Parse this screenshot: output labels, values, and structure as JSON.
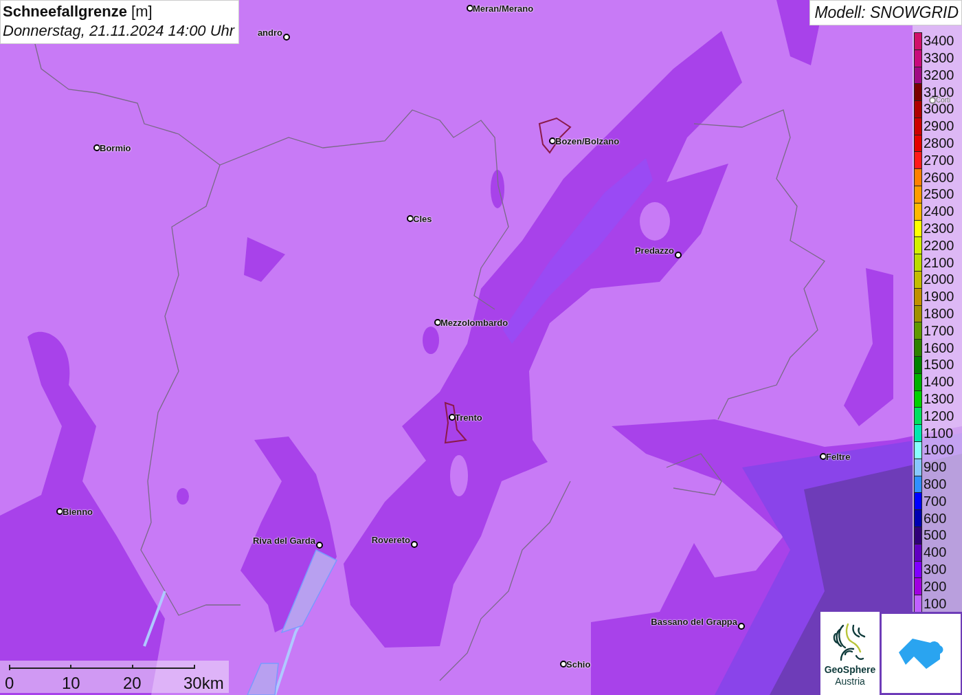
{
  "title": {
    "heading": "**Schneefallgrenze** [m]",
    "datetime": "Donnerstag, 21.11.2024 14:00 Uhr"
  },
  "model": "Modell: SNOWGRID",
  "legend": [
    {
      "label": "3400",
      "color": "#d0106a"
    },
    {
      "label": "3300",
      "color": "#c80a7c"
    },
    {
      "label": "3200",
      "color": "#a00a84"
    },
    {
      "label": "3100",
      "color": "#7a0000"
    },
    {
      "label": "3000",
      "color": "#ae0000"
    },
    {
      "label": "2900",
      "color": "#cc0000"
    },
    {
      "label": "2800",
      "color": "#e40000"
    },
    {
      "label": "2700",
      "color": "#ff1a1a"
    },
    {
      "label": "2600",
      "color": "#ff8000"
    },
    {
      "label": "2500",
      "color": "#ff9c00"
    },
    {
      "label": "2400",
      "color": "#ffb800"
    },
    {
      "label": "2300",
      "color": "#ffff00"
    },
    {
      "label": "2200",
      "color": "#d4f000"
    },
    {
      "label": "2100",
      "color": "#bcdc00"
    },
    {
      "label": "2000",
      "color": "#c4bc00"
    },
    {
      "label": "1900",
      "color": "#c09000"
    },
    {
      "label": "1800",
      "color": "#a09000"
    },
    {
      "label": "1700",
      "color": "#609800"
    },
    {
      "label": "1600",
      "color": "#2e8000"
    },
    {
      "label": "1500",
      "color": "#008000"
    },
    {
      "label": "1400",
      "color": "#00b000"
    },
    {
      "label": "1300",
      "color": "#00d000"
    },
    {
      "label": "1200",
      "color": "#00e060"
    },
    {
      "label": "1100",
      "color": "#00e8b0"
    },
    {
      "label": "1000",
      "color": "#88ffff"
    },
    {
      "label": "900",
      "color": "#88c8ff"
    },
    {
      "label": "800",
      "color": "#3090ff"
    },
    {
      "label": "700",
      "color": "#0000ff"
    },
    {
      "label": "600",
      "color": "#0000b0"
    },
    {
      "label": "500",
      "color": "#300078"
    },
    {
      "label": "400",
      "color": "#6000c0"
    },
    {
      "label": "300",
      "color": "#8000ff"
    },
    {
      "label": "200",
      "color": "#a000e0"
    },
    {
      "label": "100",
      "color": "#c060ff"
    }
  ],
  "places": [
    {
      "name": "Meran/Merano"
    },
    {
      "name": "andro"
    },
    {
      "name": "Bormio"
    },
    {
      "name": "Bozen/Bolzano"
    },
    {
      "name": "Cles"
    },
    {
      "name": "Predazzo"
    },
    {
      "name": "Mezzolombardo"
    },
    {
      "name": "Trento"
    },
    {
      "name": "Feltre"
    },
    {
      "name": "Bienno"
    },
    {
      "name": "Riva del Garda"
    },
    {
      "name": "Rovereto"
    },
    {
      "name": "Bassano del Grappa"
    },
    {
      "name": "Schio"
    },
    {
      "name": "Corti"
    }
  ],
  "scale_bar": {
    "ticks": [
      "0",
      "10",
      "20",
      "30km"
    ]
  },
  "logo": {
    "name": "GeoSphere",
    "country": "Austria"
  }
}
